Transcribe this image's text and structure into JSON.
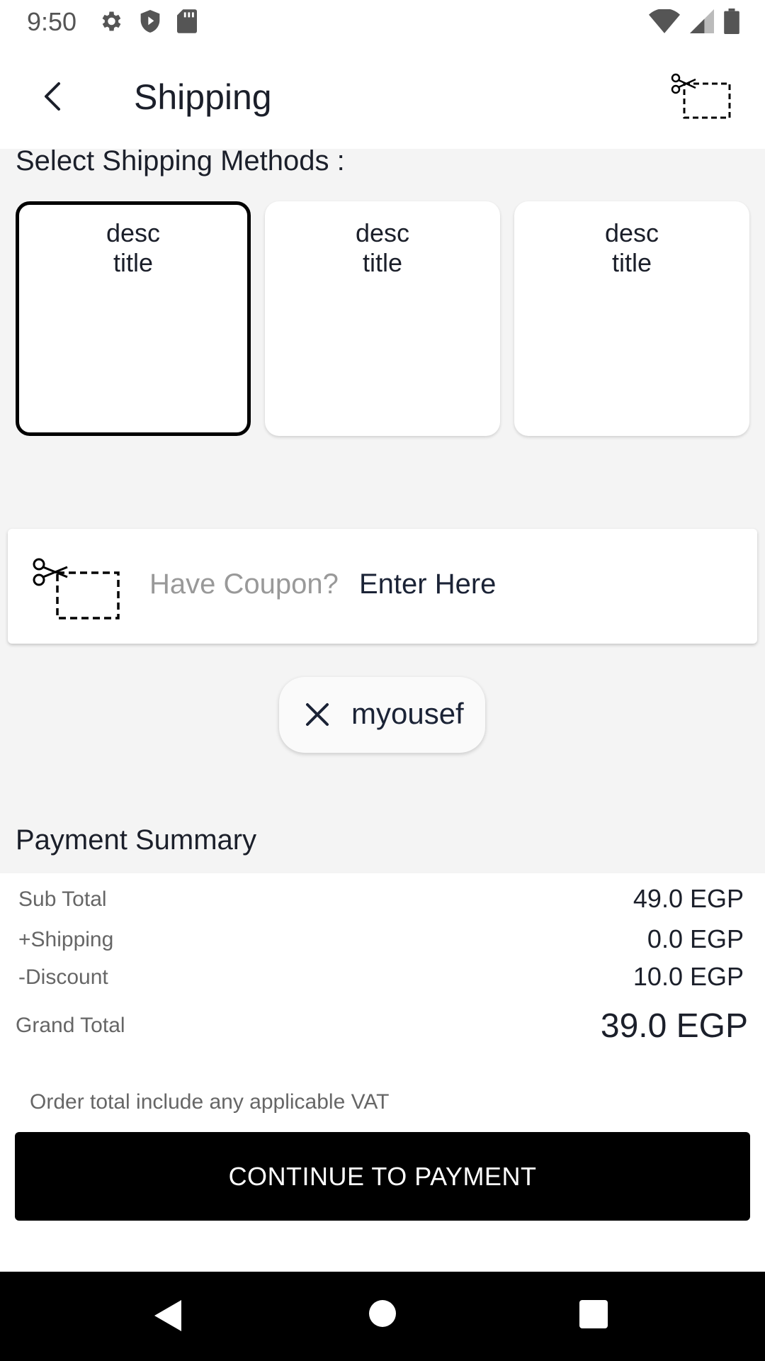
{
  "status_bar": {
    "time": "9:50",
    "left_icons": [
      "gear-icon",
      "shield-icon",
      "sd-card-icon"
    ],
    "right_icons": [
      "wifi-icon",
      "signal-icon",
      "battery-icon"
    ]
  },
  "app_bar": {
    "title": "Shipping",
    "back_icon": "chevron-left-icon",
    "coupon_icon": "scissors-coupon-icon"
  },
  "shipping": {
    "label": "Select Shipping Methods  :",
    "methods": [
      {
        "desc": "desc",
        "title": "title",
        "selected": true
      },
      {
        "desc": "desc",
        "title": "title",
        "selected": false
      },
      {
        "desc": "desc",
        "title": "title",
        "selected": false
      }
    ]
  },
  "coupon": {
    "placeholder": "Have Coupon?",
    "action": "Enter Here",
    "applied_code": "myousef"
  },
  "summary": {
    "title": "Payment Summary",
    "subtotal_label": "Sub Total",
    "subtotal_value": "49.0 EGP",
    "shipping_label": "+Shipping",
    "shipping_value": "0.0 EGP",
    "discount_label": "-Discount",
    "discount_value": "10.0 EGP",
    "grand_label": "Grand Total",
    "grand_value": "39.0 EGP",
    "vat_note": "Order total include any applicable VAT"
  },
  "actions": {
    "continue_label": "CONTINUE TO PAYMENT"
  },
  "colors": {
    "background": "#f4f4f4",
    "card": "#ffffff",
    "primary_button": "#000000",
    "text_primary": "#1b1f2a",
    "text_muted": "#666666"
  }
}
